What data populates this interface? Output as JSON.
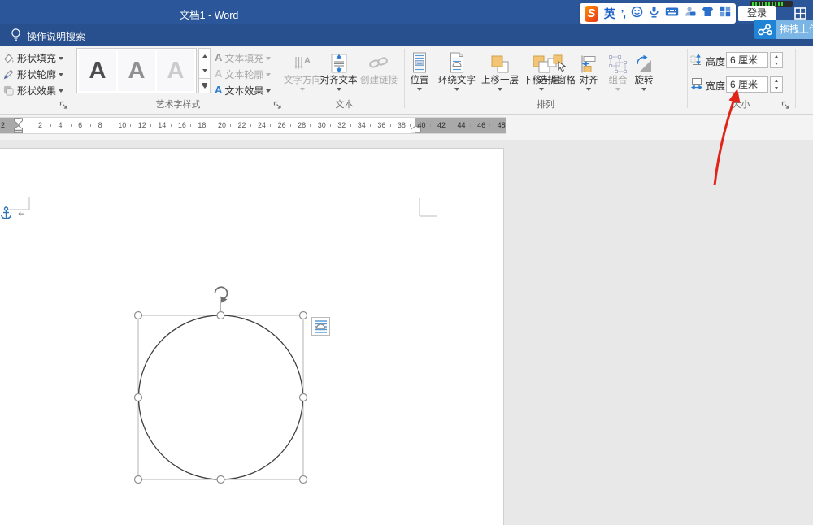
{
  "window": {
    "title": "文档1  -  Word"
  },
  "assistant_bar": {
    "search_label": "操作说明搜索"
  },
  "ime_bar": {
    "logo": "S",
    "mode": "英",
    "punct": "’,"
  },
  "account": {
    "login": "登录"
  },
  "netdisk": {
    "upload_label": "拖拽上传"
  },
  "ribbon": {
    "shape_style_group": {
      "fill": "形状填充",
      "outline": "形状轮廓",
      "effects": "形状效果"
    },
    "wordart_group": {
      "label": "艺术字样式",
      "gallery": [
        "A",
        "A",
        "A"
      ],
      "text_fill": "文本填充",
      "text_outline": "文本轮廓",
      "text_effects": "文本效果",
      "a_glyph": "A"
    },
    "text_group": {
      "label": "文本",
      "direction": "文字方向",
      "align_text": "对齐文本",
      "link": "创建链接"
    },
    "arrange_group": {
      "label": "排列",
      "position": "位置",
      "wrap": "环绕文字",
      "forward": "上移一层",
      "backward": "下移一层",
      "selection_pane": "选择窗格",
      "align": "对齐",
      "group": "组合",
      "rotate": "旋转"
    },
    "size_group": {
      "label": "大小",
      "height_label": "高度:",
      "height_value": "6 厘米",
      "width_label": "宽度:",
      "width_value": "6 厘米"
    }
  },
  "ruler": {
    "margin_number": "2",
    "numbers": [
      2,
      4,
      6,
      8,
      10,
      12,
      14,
      16,
      18,
      20,
      22,
      24,
      26,
      28,
      30,
      32,
      34,
      36,
      38
    ],
    "gray_numbers": [
      40,
      42,
      44,
      46,
      48
    ]
  },
  "colors": {
    "titlebar_blue": "#2b579a",
    "accent_orange": "#f3c473",
    "icon_blue": "#2b7cd3",
    "arrow_red": "#e0241a",
    "netdisk_blue": "#1f83d6"
  }
}
